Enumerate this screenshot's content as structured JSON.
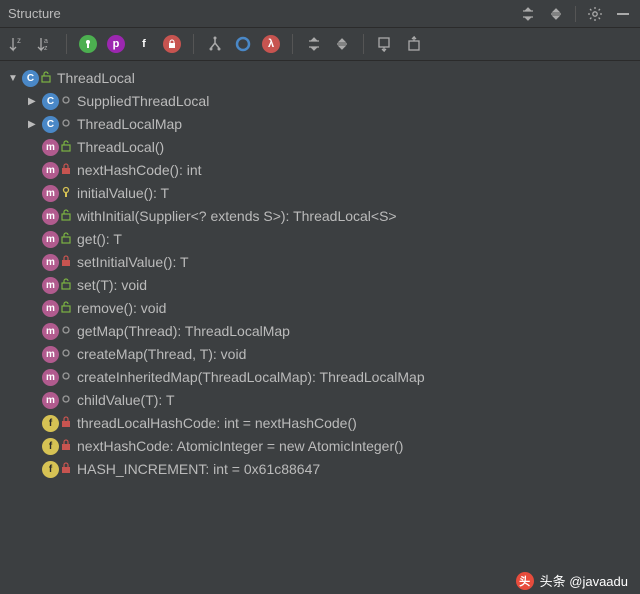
{
  "title": "Structure",
  "toolbar": {
    "sort_alpha_desc": "↓z",
    "sort_alpha_asc": "↓az"
  },
  "tree": {
    "root": {
      "label": "ThreadLocal",
      "icon_letter": "C",
      "access": "public"
    },
    "children": [
      {
        "label": "SuppliedThreadLocal",
        "kind": "class",
        "icon_letter": "C",
        "access": "package",
        "expandable": true
      },
      {
        "label": "ThreadLocalMap",
        "kind": "class",
        "icon_letter": "C",
        "access": "package",
        "expandable": true
      },
      {
        "label": "ThreadLocal()",
        "kind": "method",
        "icon_letter": "m",
        "access": "public"
      },
      {
        "label": "nextHashCode(): int",
        "kind": "method",
        "icon_letter": "m",
        "access": "private",
        "static": true
      },
      {
        "label": "initialValue(): T",
        "kind": "method",
        "icon_letter": "m",
        "access": "protected"
      },
      {
        "label": "withInitial(Supplier<? extends S>): ThreadLocal<S>",
        "kind": "method",
        "icon_letter": "m",
        "access": "public",
        "static": true
      },
      {
        "label": "get(): T",
        "kind": "method",
        "icon_letter": "m",
        "access": "public"
      },
      {
        "label": "setInitialValue(): T",
        "kind": "method",
        "icon_letter": "m",
        "access": "private"
      },
      {
        "label": "set(T): void",
        "kind": "method",
        "icon_letter": "m",
        "access": "public"
      },
      {
        "label": "remove(): void",
        "kind": "method",
        "icon_letter": "m",
        "access": "public"
      },
      {
        "label": "getMap(Thread): ThreadLocalMap",
        "kind": "method",
        "icon_letter": "m",
        "access": "package"
      },
      {
        "label": "createMap(Thread, T): void",
        "kind": "method",
        "icon_letter": "m",
        "access": "package"
      },
      {
        "label": "createInheritedMap(ThreadLocalMap): ThreadLocalMap",
        "kind": "method",
        "icon_letter": "m",
        "access": "package",
        "static": true
      },
      {
        "label": "childValue(T): T",
        "kind": "method",
        "icon_letter": "m",
        "access": "package"
      },
      {
        "label": "threadLocalHashCode: int = nextHashCode()",
        "kind": "field",
        "icon_letter": "f",
        "access": "private"
      },
      {
        "label": "nextHashCode: AtomicInteger = new AtomicInteger()",
        "kind": "field",
        "icon_letter": "f",
        "access": "private",
        "static": true
      },
      {
        "label": "HASH_INCREMENT: int = 0x61c88647",
        "kind": "field",
        "icon_letter": "f",
        "access": "private",
        "static": true
      }
    ]
  },
  "footer": {
    "badge": "头",
    "text": "头条 @javaadu"
  }
}
